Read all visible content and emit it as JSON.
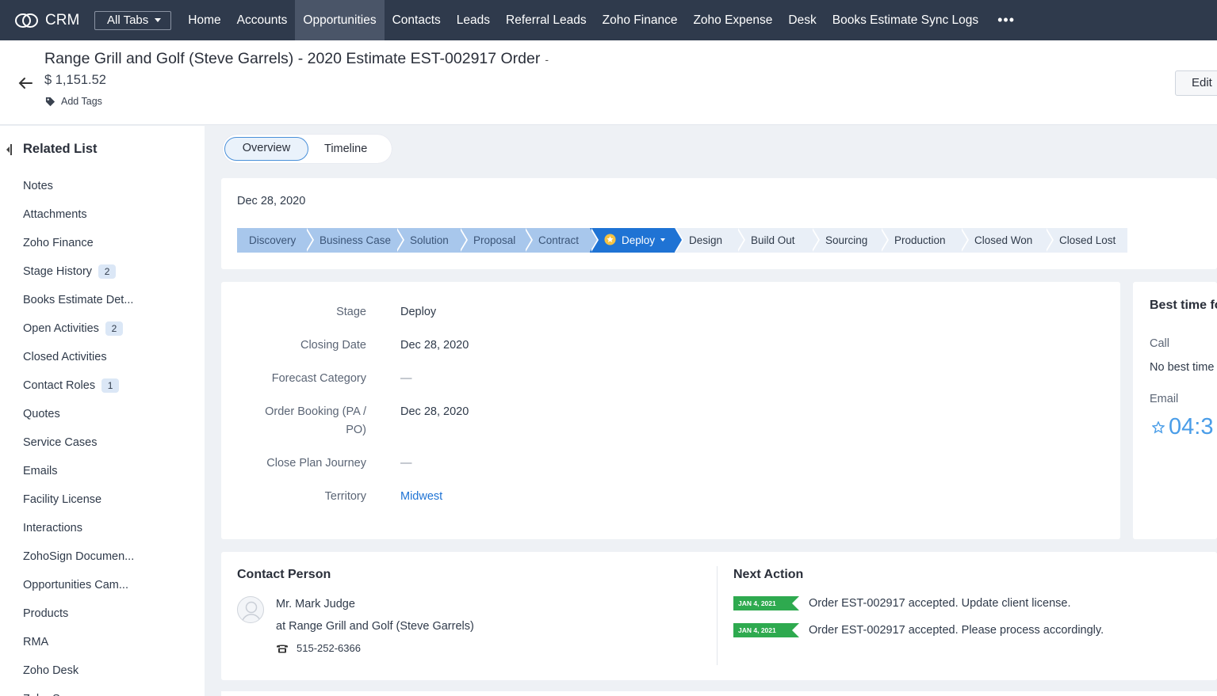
{
  "nav": {
    "brand": "CRM",
    "all_tabs": "All Tabs",
    "tabs": [
      "Home",
      "Accounts",
      "Opportunities",
      "Contacts",
      "Leads",
      "Referral Leads",
      "Zoho Finance",
      "Zoho Expense",
      "Desk",
      "Books Estimate Sync Logs"
    ],
    "active_tab": "Opportunities",
    "more": "•••"
  },
  "header": {
    "title": "Range Grill and Golf (Steve Garrels) - 2020 Estimate EST-002917 Order",
    "title_suffix": "-",
    "amount": "$ 1,151.52",
    "add_tags": "Add Tags",
    "edit": "Edit"
  },
  "sidebar": {
    "heading": "Related List",
    "items": [
      {
        "label": "Notes",
        "badge": null
      },
      {
        "label": "Attachments",
        "badge": null
      },
      {
        "label": "Zoho Finance",
        "badge": null
      },
      {
        "label": "Stage History",
        "badge": "2"
      },
      {
        "label": "Books Estimate Det...",
        "badge": null
      },
      {
        "label": "Open Activities",
        "badge": "2"
      },
      {
        "label": "Closed Activities",
        "badge": null
      },
      {
        "label": "Contact Roles",
        "badge": "1"
      },
      {
        "label": "Quotes",
        "badge": null
      },
      {
        "label": "Service Cases",
        "badge": null
      },
      {
        "label": "Emails",
        "badge": null
      },
      {
        "label": "Facility License",
        "badge": null
      },
      {
        "label": "Interactions",
        "badge": null
      },
      {
        "label": "ZohoSign Documen...",
        "badge": null
      },
      {
        "label": "Opportunities Cam...",
        "badge": null
      },
      {
        "label": "Products",
        "badge": null
      },
      {
        "label": "RMA",
        "badge": null
      },
      {
        "label": "Zoho Desk",
        "badge": null
      },
      {
        "label": "Zoho Survey",
        "badge": null
      }
    ]
  },
  "view_tabs": {
    "overview": "Overview",
    "timeline": "Timeline"
  },
  "stage_section": {
    "date": "Dec 28, 2020",
    "stages": [
      {
        "label": "Discovery",
        "state": "done"
      },
      {
        "label": "Business Case",
        "state": "done"
      },
      {
        "label": "Solution",
        "state": "done"
      },
      {
        "label": "Proposal",
        "state": "done"
      },
      {
        "label": "Contract",
        "state": "done"
      },
      {
        "label": "Deploy",
        "state": "current"
      },
      {
        "label": "Design",
        "state": "todo"
      },
      {
        "label": "Build Out",
        "state": "todo"
      },
      {
        "label": "Sourcing",
        "state": "todo"
      },
      {
        "label": "Production",
        "state": "todo"
      },
      {
        "label": "Closed Won",
        "state": "todo"
      },
      {
        "label": "Closed Lost",
        "state": "todo"
      }
    ]
  },
  "details": {
    "fields": [
      {
        "label": "Stage",
        "value": "Deploy",
        "kind": "text"
      },
      {
        "label": "Closing Date",
        "value": "Dec 28, 2020",
        "kind": "text"
      },
      {
        "label": "Forecast Category",
        "value": "—",
        "kind": "empty"
      },
      {
        "label": "Order Booking (PA / PO)",
        "value": "Dec 28, 2020",
        "kind": "text"
      },
      {
        "label": "Close Plan Journey",
        "value": "—",
        "kind": "empty"
      },
      {
        "label": "Territory",
        "value": "Midwest",
        "kind": "link"
      }
    ]
  },
  "best_time": {
    "title": "Best time fo",
    "call_label": "Call",
    "call_value": "No best time",
    "email_label": "Email",
    "email_time": "04:3"
  },
  "contact_person": {
    "title": "Contact Person",
    "name": "Mr. Mark Judge",
    "company": "at Range Grill and Golf (Steve Garrels)",
    "phone": "515-252-6366"
  },
  "next_action": {
    "title": "Next Action",
    "items": [
      {
        "date": "JAN 4, 2021",
        "text": "Order EST-002917 accepted. Update client license."
      },
      {
        "date": "JAN 4, 2021",
        "text": "Order EST-002917 accepted. Please process accordingly."
      }
    ]
  },
  "colors": {
    "nav_bg": "#2f3a4c",
    "stage_done": "#a8c7ec",
    "stage_current": "#1f73d4",
    "flag_green": "#2eaa4f",
    "link": "#1f73d4"
  }
}
